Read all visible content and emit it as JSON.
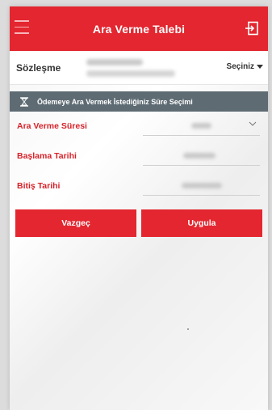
{
  "header": {
    "title": "Ara Verme Talebi",
    "menu_icon": "hamburger-icon",
    "logout_icon": "logout-icon"
  },
  "contract": {
    "label": "Sözleşme",
    "select_label": "Seçiniz"
  },
  "section": {
    "title": "Ödemeye Ara Vermek İstediğiniz Süre Seçimi",
    "icon": "hourglass-icon"
  },
  "fields": [
    {
      "label": "Ara Verme Süresi"
    },
    {
      "label": "Başlama Tarihi"
    },
    {
      "label": "Bitiş Tarihi"
    }
  ],
  "actions": {
    "cancel_label": "Vazgeç",
    "apply_label": "Uygula"
  },
  "colors": {
    "accent": "#e3262f",
    "section_bar": "#5e6b73",
    "field_label": "#d72229"
  }
}
